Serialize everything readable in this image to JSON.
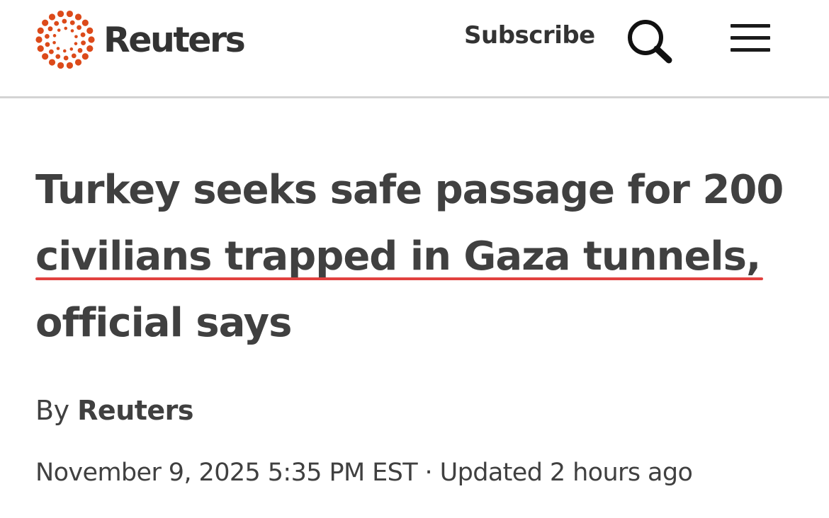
{
  "header": {
    "logo_text": "Reuters",
    "subscribe_label": "Subscribe",
    "search_icon": "search-icon",
    "menu_icon": "hamburger-menu-icon",
    "brand_color": "#dc4a1a"
  },
  "article": {
    "headline_lines": [
      "Turkey seeks safe passage for 200",
      "civilians trapped in Gaza tunnels,",
      "official says"
    ],
    "underline_color": "#e1413f",
    "byline_prefix": "By",
    "byline_author": "Reuters",
    "date": "November 9, 2025 5:35 PM EST",
    "separator": "·",
    "updated": "Updated 2 hours ago"
  }
}
